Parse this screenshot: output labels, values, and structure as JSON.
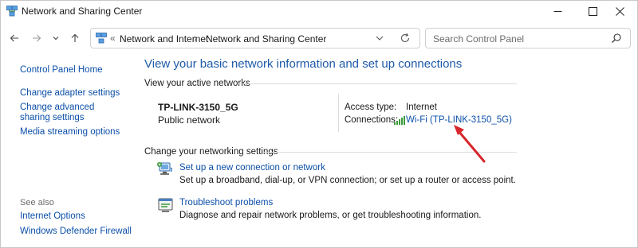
{
  "window": {
    "title": "Network and Sharing Center"
  },
  "address_bar": {
    "overflow": "«",
    "crumbs": [
      "Network and Internet",
      "Network and Sharing Center"
    ],
    "separator": "›"
  },
  "search": {
    "placeholder": "Search Control Panel"
  },
  "sidebar": {
    "links": [
      "Control Panel Home",
      "Change adapter settings",
      "Change advanced sharing settings",
      "Media streaming options"
    ],
    "see_also_label": "See also",
    "see_also_links": [
      "Internet Options",
      "Windows Defender Firewall"
    ]
  },
  "main": {
    "title": "View your basic network information and set up connections",
    "active_networks_header": "View your active networks",
    "network": {
      "name": "TP-LINK-3150_5G",
      "type": "Public network",
      "access_type_label": "Access type:",
      "access_type_value": "Internet",
      "connections_label": "Connections:",
      "connection_link": "Wi-Fi (TP-LINK-3150_5G)"
    },
    "change_settings_header": "Change your networking settings",
    "tasks": [
      {
        "icon": "new-connection-icon",
        "link": "Set up a new connection or network",
        "desc": "Set up a broadband, dial-up, or VPN connection; or set up a router or access point."
      },
      {
        "icon": "troubleshoot-icon",
        "link": "Troubleshoot problems",
        "desc": "Diagnose and repair network problems, or get troubleshooting information."
      }
    ]
  },
  "annotation": {
    "arrow_color": "#d8262b"
  }
}
